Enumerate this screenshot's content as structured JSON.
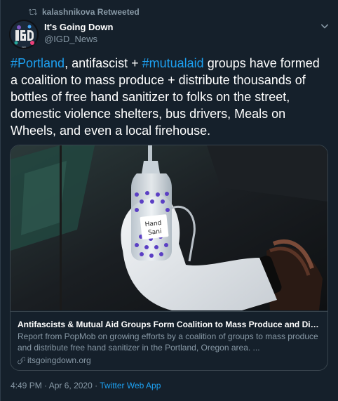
{
  "retweet": {
    "icon": "retweet-icon",
    "text": "kalashnikova Retweeted"
  },
  "author": {
    "avatar_text": "IGD",
    "display_name": "It's Going Down",
    "handle": "@IGD_News"
  },
  "menu": {
    "icon": "chevron-down-icon"
  },
  "tweet": {
    "segments": [
      {
        "text": "#Portland",
        "type": "hashtag"
      },
      {
        "text": ", antifascist + ",
        "type": "text"
      },
      {
        "text": "#mutualaid",
        "type": "hashtag"
      },
      {
        "text": " groups have formed a coalition to mass produce + distribute thousands of bottles of free hand sanitizer to folks on the street, domestic violence shelters, bus drivers, Meals on Wheels, and even a local firehouse.",
        "type": "text"
      }
    ]
  },
  "card": {
    "image_label_line1": "Hand",
    "image_label_line2": "Sani",
    "title": "Antifascists & Mutual Aid Groups Form Coalition to Mass Produce and Distrib...",
    "description": "Report from PopMob on growing efforts by a coalition of groups to mass produce and distribute free hand sanitizer in the Portland, Oregon area. ...",
    "domain_icon": "link-icon",
    "domain": "itsgoingdown.org"
  },
  "meta": {
    "time": "4:49 PM",
    "separator1": " · ",
    "date": "Apr 6, 2020",
    "separator2": " · ",
    "source": "Twitter Web App"
  },
  "colors": {
    "background": "#15202b",
    "accent": "#1da1f2",
    "secondary_text": "#8899a6",
    "border": "#38444d"
  }
}
